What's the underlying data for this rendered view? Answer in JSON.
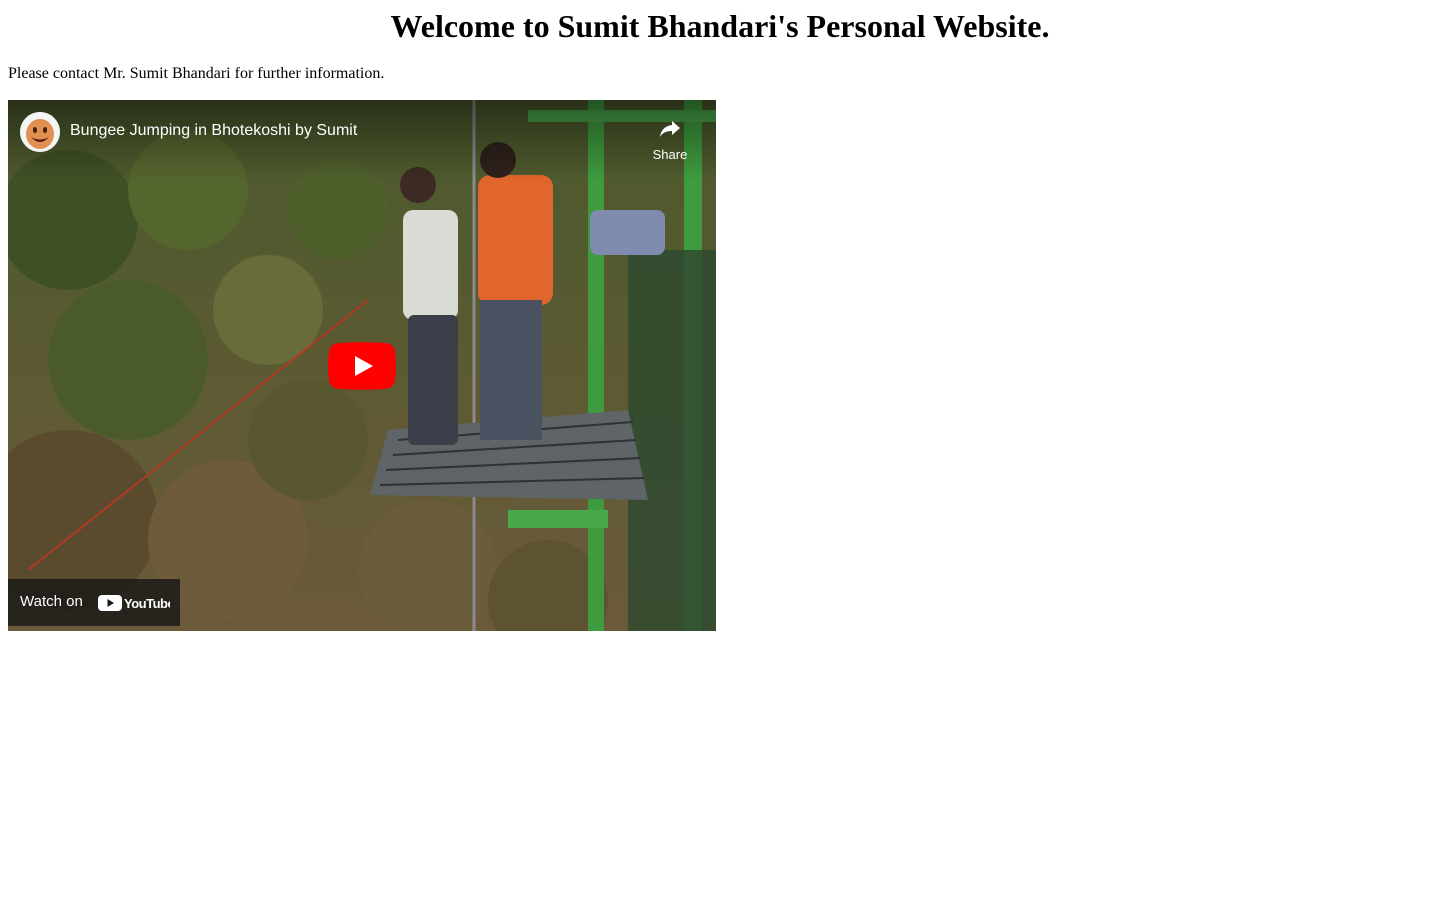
{
  "page": {
    "heading": "Welcome to Sumit Bhandari's Personal Website.",
    "contact_text": "Please contact Mr. Sumit Bhandari for further information."
  },
  "video": {
    "title": "Bungee Jumping in Bhotekoshi by Sumit",
    "share_label": "Share",
    "watch_on_label": "Watch on",
    "brand": "YouTube",
    "icons": {
      "avatar": "channel-avatar-icon",
      "share": "share-arrow-icon",
      "play": "play-button-icon",
      "logo": "youtube-logo-icon"
    },
    "colors": {
      "play_button": "#ff0000",
      "overlay_bar": "#171717"
    }
  }
}
